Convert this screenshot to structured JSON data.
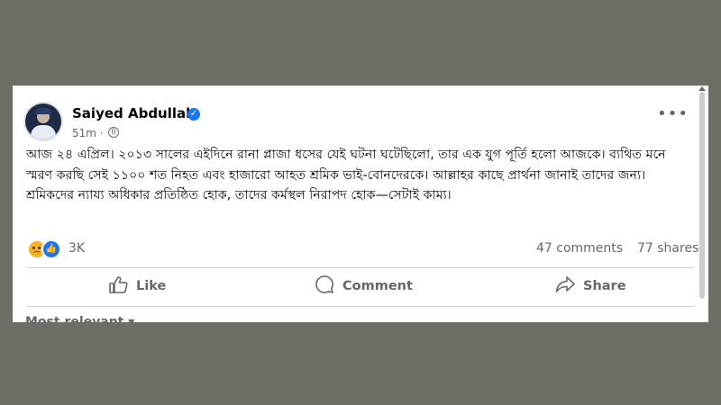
{
  "post": {
    "author": "Saiyed Abdullah",
    "time": "51m ·",
    "text": "আজ ২৪ এপ্রিল। ২০১৩ সালের এইদিনে রানা প্লাজা ধসের যেই ঘটনা ঘটেছিলো, তার এক যুগ পূর্তি হলো আজকে। ব্যথিত মনে স্মরণ করছি সেই ১১০০ শত নিহত এবং হাজারো আহত শ্রমিক ভাই-বোনদেরকে। আল্লাহর কাছে প্রার্থনা জানাই তাদের জন্য। শ্রমিকদের ন্যায্য অধিকার প্রতিষ্ঠিত হোক, তাদের কর্মস্থল নিরাপদ হোক—সেটাই কাম্য।",
    "more_icon": "ellipsis-icon"
  },
  "stats": {
    "reactions": [
      "sad",
      "like"
    ],
    "reaction_count": "3K",
    "comments": "47 comments",
    "shares": "77 shares"
  },
  "actions": {
    "like": "Like",
    "comment": "Comment",
    "share": "Share"
  },
  "comments_filter": "Most relevant ▾",
  "colors": {
    "background": "#6e6e66",
    "card": "#ffffff",
    "verified": "#1877f2",
    "muted_text": "#65676b"
  }
}
